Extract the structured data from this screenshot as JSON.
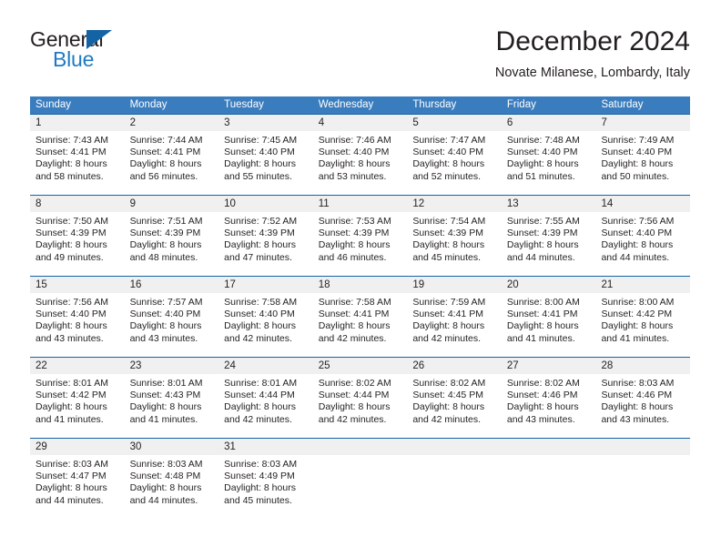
{
  "brand": {
    "name_part1": "General",
    "name_part2": "Blue",
    "accent_color": "#1464a5",
    "blue_text_color": "#1f7ac4"
  },
  "header": {
    "title": "December 2024",
    "subtitle": "Novate Milanese, Lombardy, Italy"
  },
  "calendar": {
    "header_bg": "#3a7dbf",
    "separator_color": "#1464a5",
    "daynum_bg": "#f0f0f0",
    "weekdays": [
      "Sunday",
      "Monday",
      "Tuesday",
      "Wednesday",
      "Thursday",
      "Friday",
      "Saturday"
    ],
    "weeks": [
      [
        {
          "day": "1",
          "sunrise": "Sunrise: 7:43 AM",
          "sunset": "Sunset: 4:41 PM",
          "daylight_line1": "Daylight: 8 hours",
          "daylight_line2": "and 58 minutes."
        },
        {
          "day": "2",
          "sunrise": "Sunrise: 7:44 AM",
          "sunset": "Sunset: 4:41 PM",
          "daylight_line1": "Daylight: 8 hours",
          "daylight_line2": "and 56 minutes."
        },
        {
          "day": "3",
          "sunrise": "Sunrise: 7:45 AM",
          "sunset": "Sunset: 4:40 PM",
          "daylight_line1": "Daylight: 8 hours",
          "daylight_line2": "and 55 minutes."
        },
        {
          "day": "4",
          "sunrise": "Sunrise: 7:46 AM",
          "sunset": "Sunset: 4:40 PM",
          "daylight_line1": "Daylight: 8 hours",
          "daylight_line2": "and 53 minutes."
        },
        {
          "day": "5",
          "sunrise": "Sunrise: 7:47 AM",
          "sunset": "Sunset: 4:40 PM",
          "daylight_line1": "Daylight: 8 hours",
          "daylight_line2": "and 52 minutes."
        },
        {
          "day": "6",
          "sunrise": "Sunrise: 7:48 AM",
          "sunset": "Sunset: 4:40 PM",
          "daylight_line1": "Daylight: 8 hours",
          "daylight_line2": "and 51 minutes."
        },
        {
          "day": "7",
          "sunrise": "Sunrise: 7:49 AM",
          "sunset": "Sunset: 4:40 PM",
          "daylight_line1": "Daylight: 8 hours",
          "daylight_line2": "and 50 minutes."
        }
      ],
      [
        {
          "day": "8",
          "sunrise": "Sunrise: 7:50 AM",
          "sunset": "Sunset: 4:39 PM",
          "daylight_line1": "Daylight: 8 hours",
          "daylight_line2": "and 49 minutes."
        },
        {
          "day": "9",
          "sunrise": "Sunrise: 7:51 AM",
          "sunset": "Sunset: 4:39 PM",
          "daylight_line1": "Daylight: 8 hours",
          "daylight_line2": "and 48 minutes."
        },
        {
          "day": "10",
          "sunrise": "Sunrise: 7:52 AM",
          "sunset": "Sunset: 4:39 PM",
          "daylight_line1": "Daylight: 8 hours",
          "daylight_line2": "and 47 minutes."
        },
        {
          "day": "11",
          "sunrise": "Sunrise: 7:53 AM",
          "sunset": "Sunset: 4:39 PM",
          "daylight_line1": "Daylight: 8 hours",
          "daylight_line2": "and 46 minutes."
        },
        {
          "day": "12",
          "sunrise": "Sunrise: 7:54 AM",
          "sunset": "Sunset: 4:39 PM",
          "daylight_line1": "Daylight: 8 hours",
          "daylight_line2": "and 45 minutes."
        },
        {
          "day": "13",
          "sunrise": "Sunrise: 7:55 AM",
          "sunset": "Sunset: 4:39 PM",
          "daylight_line1": "Daylight: 8 hours",
          "daylight_line2": "and 44 minutes."
        },
        {
          "day": "14",
          "sunrise": "Sunrise: 7:56 AM",
          "sunset": "Sunset: 4:40 PM",
          "daylight_line1": "Daylight: 8 hours",
          "daylight_line2": "and 44 minutes."
        }
      ],
      [
        {
          "day": "15",
          "sunrise": "Sunrise: 7:56 AM",
          "sunset": "Sunset: 4:40 PM",
          "daylight_line1": "Daylight: 8 hours",
          "daylight_line2": "and 43 minutes."
        },
        {
          "day": "16",
          "sunrise": "Sunrise: 7:57 AM",
          "sunset": "Sunset: 4:40 PM",
          "daylight_line1": "Daylight: 8 hours",
          "daylight_line2": "and 43 minutes."
        },
        {
          "day": "17",
          "sunrise": "Sunrise: 7:58 AM",
          "sunset": "Sunset: 4:40 PM",
          "daylight_line1": "Daylight: 8 hours",
          "daylight_line2": "and 42 minutes."
        },
        {
          "day": "18",
          "sunrise": "Sunrise: 7:58 AM",
          "sunset": "Sunset: 4:41 PM",
          "daylight_line1": "Daylight: 8 hours",
          "daylight_line2": "and 42 minutes."
        },
        {
          "day": "19",
          "sunrise": "Sunrise: 7:59 AM",
          "sunset": "Sunset: 4:41 PM",
          "daylight_line1": "Daylight: 8 hours",
          "daylight_line2": "and 42 minutes."
        },
        {
          "day": "20",
          "sunrise": "Sunrise: 8:00 AM",
          "sunset": "Sunset: 4:41 PM",
          "daylight_line1": "Daylight: 8 hours",
          "daylight_line2": "and 41 minutes."
        },
        {
          "day": "21",
          "sunrise": "Sunrise: 8:00 AM",
          "sunset": "Sunset: 4:42 PM",
          "daylight_line1": "Daylight: 8 hours",
          "daylight_line2": "and 41 minutes."
        }
      ],
      [
        {
          "day": "22",
          "sunrise": "Sunrise: 8:01 AM",
          "sunset": "Sunset: 4:42 PM",
          "daylight_line1": "Daylight: 8 hours",
          "daylight_line2": "and 41 minutes."
        },
        {
          "day": "23",
          "sunrise": "Sunrise: 8:01 AM",
          "sunset": "Sunset: 4:43 PM",
          "daylight_line1": "Daylight: 8 hours",
          "daylight_line2": "and 41 minutes."
        },
        {
          "day": "24",
          "sunrise": "Sunrise: 8:01 AM",
          "sunset": "Sunset: 4:44 PM",
          "daylight_line1": "Daylight: 8 hours",
          "daylight_line2": "and 42 minutes."
        },
        {
          "day": "25",
          "sunrise": "Sunrise: 8:02 AM",
          "sunset": "Sunset: 4:44 PM",
          "daylight_line1": "Daylight: 8 hours",
          "daylight_line2": "and 42 minutes."
        },
        {
          "day": "26",
          "sunrise": "Sunrise: 8:02 AM",
          "sunset": "Sunset: 4:45 PM",
          "daylight_line1": "Daylight: 8 hours",
          "daylight_line2": "and 42 minutes."
        },
        {
          "day": "27",
          "sunrise": "Sunrise: 8:02 AM",
          "sunset": "Sunset: 4:46 PM",
          "daylight_line1": "Daylight: 8 hours",
          "daylight_line2": "and 43 minutes."
        },
        {
          "day": "28",
          "sunrise": "Sunrise: 8:03 AM",
          "sunset": "Sunset: 4:46 PM",
          "daylight_line1": "Daylight: 8 hours",
          "daylight_line2": "and 43 minutes."
        }
      ],
      [
        {
          "day": "29",
          "sunrise": "Sunrise: 8:03 AM",
          "sunset": "Sunset: 4:47 PM",
          "daylight_line1": "Daylight: 8 hours",
          "daylight_line2": "and 44 minutes."
        },
        {
          "day": "30",
          "sunrise": "Sunrise: 8:03 AM",
          "sunset": "Sunset: 4:48 PM",
          "daylight_line1": "Daylight: 8 hours",
          "daylight_line2": "and 44 minutes."
        },
        {
          "day": "31",
          "sunrise": "Sunrise: 8:03 AM",
          "sunset": "Sunset: 4:49 PM",
          "daylight_line1": "Daylight: 8 hours",
          "daylight_line2": "and 45 minutes."
        },
        {
          "day": "",
          "sunrise": "",
          "sunset": "",
          "daylight_line1": "",
          "daylight_line2": ""
        },
        {
          "day": "",
          "sunrise": "",
          "sunset": "",
          "daylight_line1": "",
          "daylight_line2": ""
        },
        {
          "day": "",
          "sunrise": "",
          "sunset": "",
          "daylight_line1": "",
          "daylight_line2": ""
        },
        {
          "day": "",
          "sunrise": "",
          "sunset": "",
          "daylight_line1": "",
          "daylight_line2": ""
        }
      ]
    ]
  }
}
